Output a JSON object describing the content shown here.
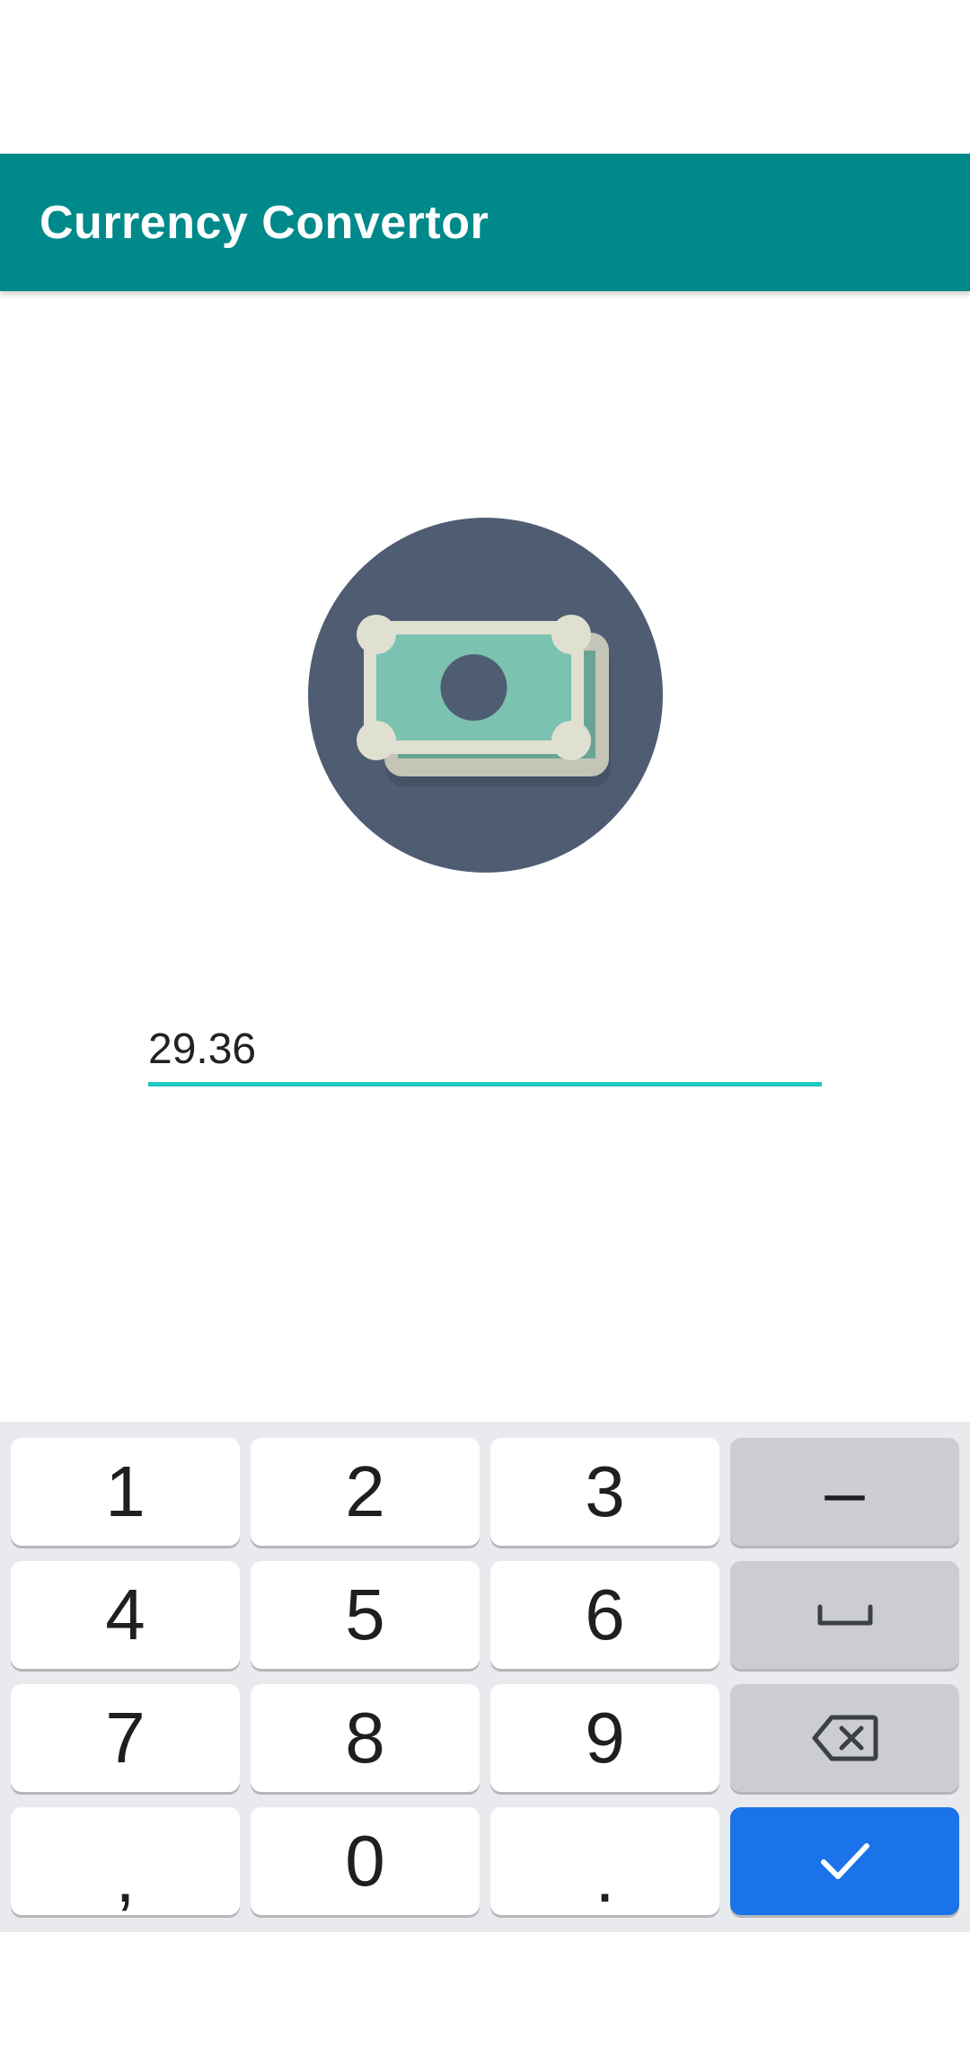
{
  "app_bar": {
    "title": "Currency Convertor",
    "background_color": "#00898a"
  },
  "logo": {
    "icon": "money-icon",
    "circle_color": "#4f5d73",
    "bill_color": "#7bc2b0",
    "frame_color": "#e0e0d1"
  },
  "amount": {
    "value": "29.36",
    "underline_color": "#1fc8c0"
  },
  "keyboard": {
    "accent_color": "#1a73e8",
    "keys": [
      {
        "name": "key-1",
        "label": "1",
        "style": "light",
        "col": 0,
        "row": 0
      },
      {
        "name": "key-2",
        "label": "2",
        "style": "light",
        "col": 1,
        "row": 0
      },
      {
        "name": "key-3",
        "label": "3",
        "style": "light",
        "col": 2,
        "row": 0
      },
      {
        "name": "key-minus",
        "label": "–",
        "style": "dark",
        "col": 3,
        "row": 0
      },
      {
        "name": "key-4",
        "label": "4",
        "style": "light",
        "col": 0,
        "row": 1
      },
      {
        "name": "key-5",
        "label": "5",
        "style": "light",
        "col": 1,
        "row": 1
      },
      {
        "name": "key-6",
        "label": "6",
        "style": "light",
        "col": 2,
        "row": 1
      },
      {
        "name": "key-space",
        "label": "",
        "icon": "space-icon",
        "style": "dark",
        "col": 3,
        "row": 1
      },
      {
        "name": "key-7",
        "label": "7",
        "style": "light",
        "col": 0,
        "row": 2
      },
      {
        "name": "key-8",
        "label": "8",
        "style": "light",
        "col": 1,
        "row": 2
      },
      {
        "name": "key-9",
        "label": "9",
        "style": "light",
        "col": 2,
        "row": 2
      },
      {
        "name": "key-backspace",
        "label": "",
        "icon": "backspace-icon",
        "style": "dark",
        "col": 3,
        "row": 2
      },
      {
        "name": "key-comma",
        "label": ",",
        "style": "light",
        "col": 0,
        "row": 3
      },
      {
        "name": "key-0",
        "label": "0",
        "style": "light",
        "col": 1,
        "row": 3
      },
      {
        "name": "key-period",
        "label": ".",
        "style": "light",
        "col": 2,
        "row": 3
      },
      {
        "name": "key-done",
        "label": "",
        "icon": "check-icon",
        "style": "action",
        "col": 3,
        "row": 3
      }
    ]
  }
}
